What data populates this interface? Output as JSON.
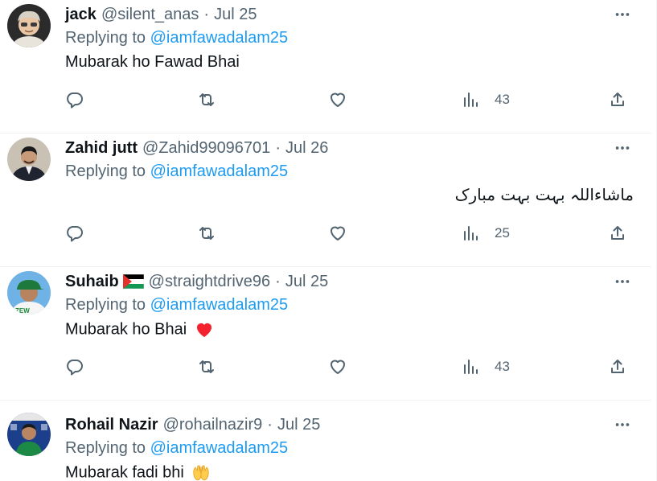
{
  "tweets": [
    {
      "name": "jack",
      "handle": "@silent_anas",
      "dot": "·",
      "date": "Jul 25",
      "replying_prefix": "Replying to ",
      "replying_to": "@iamfawadalam25",
      "text": "Mubarak ho Fawad Bhai",
      "views": "43"
    },
    {
      "name": "Zahid jutt",
      "handle": "@Zahid99096701",
      "dot": "·",
      "date": "Jul 26",
      "replying_prefix": "Replying to ",
      "replying_to": "@iamfawadalam25",
      "text": "ماشاءاللہ بہت بہت مبارک",
      "views": "25"
    },
    {
      "name": "Suhaib",
      "flag_icon": "palestine-flag-icon",
      "handle": "@straightdrive96",
      "dot": "·",
      "date": "Jul 25",
      "replying_prefix": "Replying to ",
      "replying_to": "@iamfawadalam25",
      "text": "Mubarak ho Bhai",
      "emoji_icon": "red-heart-icon",
      "views": "43"
    },
    {
      "name": "Rohail Nazir",
      "handle": "@rohailnazir9",
      "dot": "·",
      "date": "Jul 25",
      "replying_prefix": "Replying to ",
      "replying_to": "@iamfawadalam25",
      "text": "Mubarak fadi bhi",
      "emoji_icon": "raising-hands-icon"
    }
  ],
  "icons": {
    "reply": "reply-icon",
    "retweet": "retweet-icon",
    "like": "like-icon",
    "views": "views-icon",
    "share": "share-icon",
    "more": "more-icon"
  },
  "colors": {
    "text_primary": "#0f1419",
    "text_secondary": "#536471",
    "link": "#1d9bf0",
    "divider": "#eff3f4",
    "heart": "#f4212e"
  }
}
